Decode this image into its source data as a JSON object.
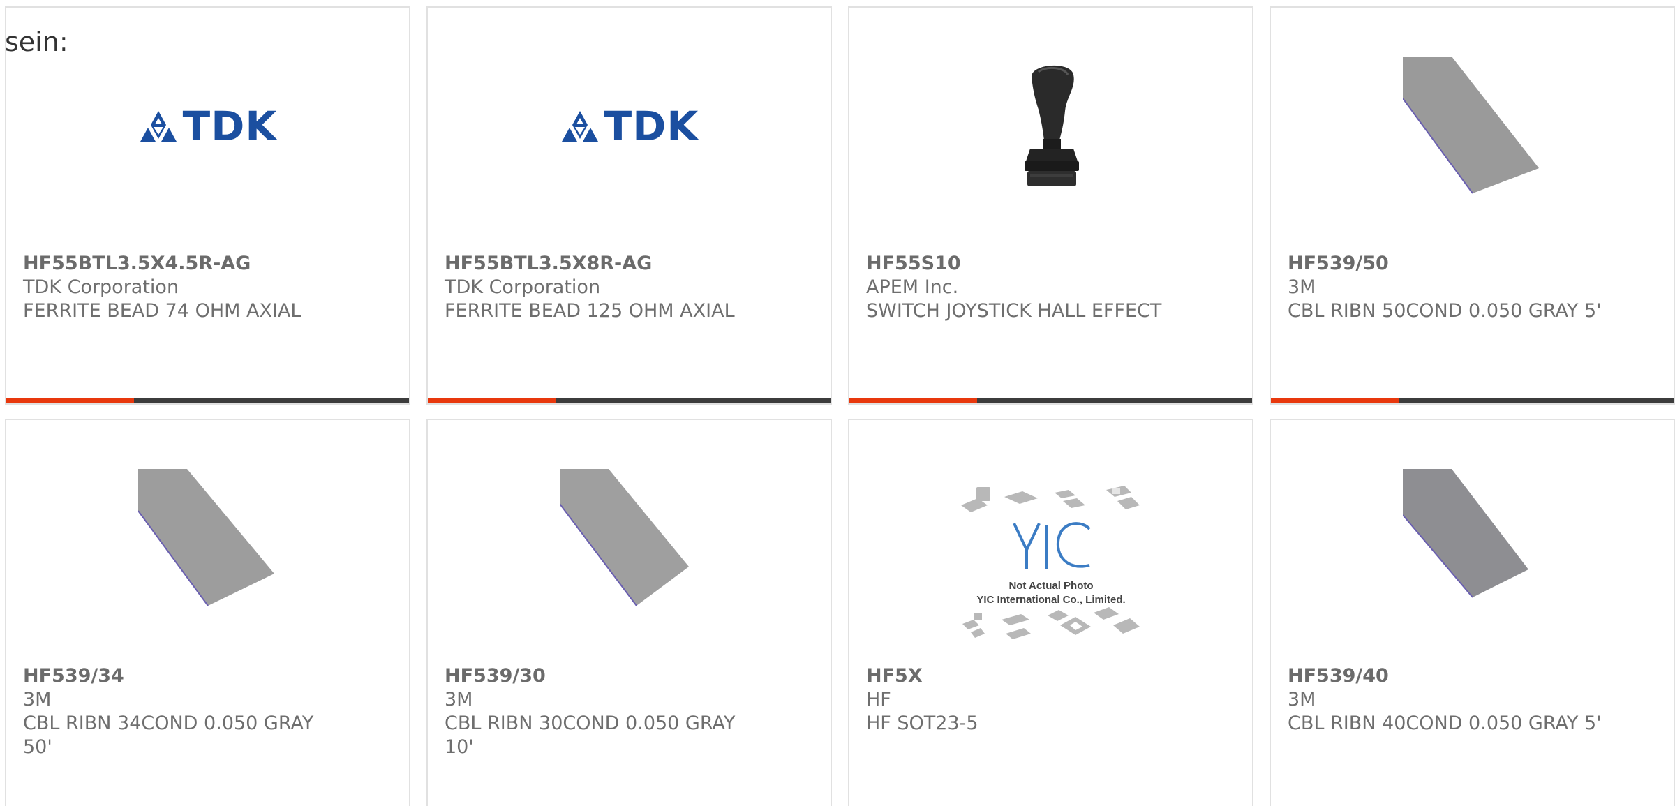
{
  "lead_text": "sein:",
  "colors": {
    "accent": "#e8380d",
    "bar_dark": "#3c3c3c",
    "tdk_blue": "#1b4fa0",
    "text_gray": "#6e6e6e"
  },
  "products": [
    {
      "part_number": "HF55BTL3.5X4.5R-AG",
      "manufacturer": "TDK Corporation",
      "description": "FERRITE BEAD 74 OHM AXIAL",
      "image": "tdk-logo"
    },
    {
      "part_number": "HF55BTL3.5X8R-AG",
      "manufacturer": "TDK Corporation",
      "description": "FERRITE BEAD 125 OHM AXIAL",
      "image": "tdk-logo"
    },
    {
      "part_number": "HF55S10",
      "manufacturer": "APEM Inc.",
      "description": "SWITCH JOYSTICK HALL EFFECT",
      "image": "joystick-photo"
    },
    {
      "part_number": "HF539/50",
      "manufacturer": "3M",
      "description": "CBL RIBN 50COND 0.050 GRAY 5'",
      "image": "ribbon-cable-photo"
    },
    {
      "part_number": "HF539/34",
      "manufacturer": "3M",
      "description": "CBL RIBN 34COND 0.050 GRAY 50'",
      "image": "ribbon-cable-photo"
    },
    {
      "part_number": "HF539/30",
      "manufacturer": "3M",
      "description": "CBL RIBN 30COND 0.050 GRAY 10'",
      "image": "ribbon-cable-photo"
    },
    {
      "part_number": "HF5X",
      "manufacturer": "HF",
      "description": "HF SOT23-5",
      "image": "placeholder-photo",
      "image_caption_1": "Not Actual Photo",
      "image_caption_2": "YIC International Co., Limited.",
      "image_logo": "YIC"
    },
    {
      "part_number": "HF539/40",
      "manufacturer": "3M",
      "description": "CBL RIBN 40COND 0.050 GRAY 5'",
      "image": "ribbon-cable-photo"
    }
  ]
}
